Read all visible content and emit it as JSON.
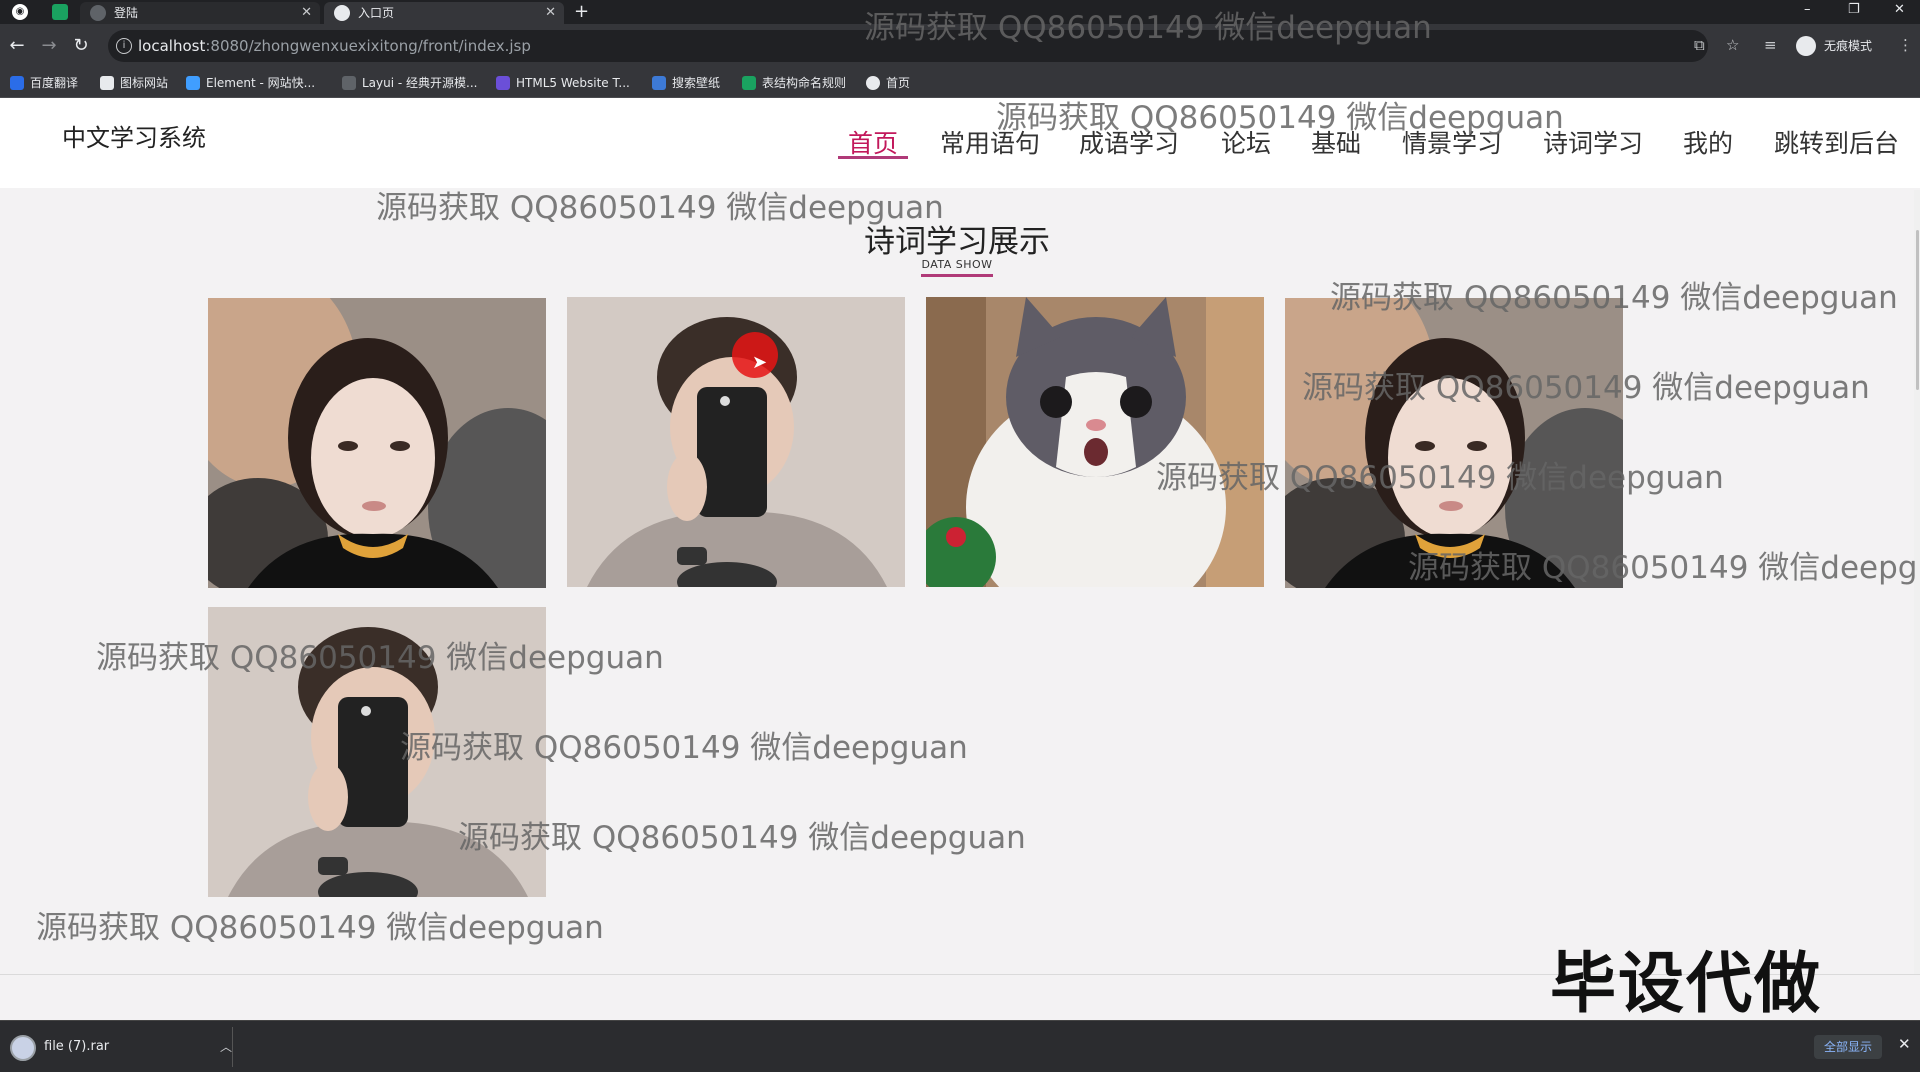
{
  "browser": {
    "tabs": [
      {
        "label": "登陆",
        "active": false
      },
      {
        "label": "入口页",
        "active": true
      }
    ],
    "new_tab": "+",
    "window_controls": [
      "–",
      "❐",
      "✕"
    ],
    "url_host": "localhost",
    "url_rest": ":8080/zhongwenxuexixitong/front/index.jsp",
    "incognito_label": "无痕模式",
    "bookmarks": [
      "百度翻译",
      "图标网站",
      "Element - 网站快...",
      "Layui - 经典开源模...",
      "HTML5 Website T...",
      "搜索壁纸",
      "表结构命名规则",
      "首页"
    ]
  },
  "site": {
    "logo": "中文学习系统",
    "nav": [
      "首页",
      "常用语句",
      "成语学习",
      "论坛",
      "基础",
      "情景学习",
      "诗词学习",
      "我的",
      "跳转到后台"
    ],
    "active_nav": "首页"
  },
  "section": {
    "title": "诗词学习展示",
    "subtitle": "DATA SHOW"
  },
  "cards": [
    {
      "subject": "girl-portrait"
    },
    {
      "subject": "boy-phone-selfie"
    },
    {
      "subject": "surprised-cat"
    },
    {
      "subject": "girl-portrait"
    },
    {
      "subject": "boy-phone-selfie"
    }
  ],
  "watermark_text": "源码获取 QQ86050149 微信deepguan",
  "stamp": "毕设代做",
  "download_bar": {
    "file": "file (7).rar",
    "show_all": "全部显示",
    "close": "✕"
  }
}
